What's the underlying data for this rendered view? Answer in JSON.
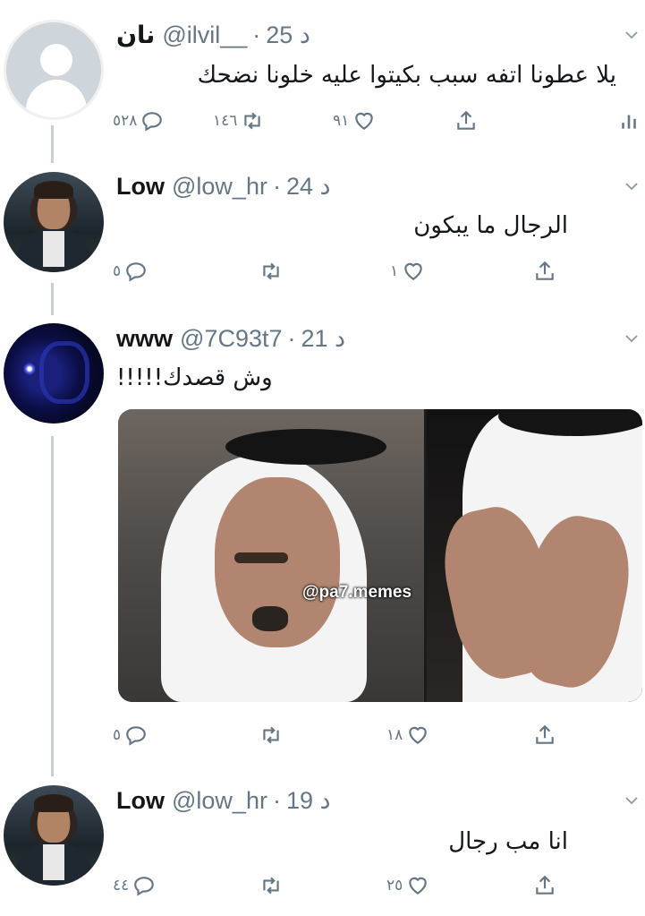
{
  "thread": [
    {
      "name": "نان",
      "handle": "@ilvil__",
      "time": "25 د",
      "separator": "·",
      "text": "يلا عطونا اتفه سبب بكيتوا عليه خلونا نضحك",
      "replies": "٥٢٨",
      "retweets": "١٤٦",
      "likes": "٩١",
      "avatar_icon": "default-avatar-icon"
    },
    {
      "name": "Low",
      "handle": "@low_hr",
      "time": "24 د",
      "separator": "·",
      "text": "الرجال ما يبكون",
      "replies": "٥",
      "retweets": "",
      "likes": "١",
      "avatar_icon": "profile-photo"
    },
    {
      "name": "www",
      "handle": "@7C93t7",
      "time": "21 د",
      "separator": "·",
      "text": "وش قصدك!!!!!",
      "replies": "٥",
      "retweets": "",
      "likes": "١٨",
      "avatar_icon": "profile-photo",
      "media_watermark": "@pa7.memes"
    },
    {
      "name": "Low",
      "handle": "@low_hr",
      "time": "19 د",
      "separator": "·",
      "text": "انا مب رجال",
      "replies": "٤٤",
      "retweets": "",
      "likes": "٢٥",
      "avatar_icon": "profile-photo"
    }
  ],
  "icons": {
    "reply": "reply-icon",
    "retweet": "retweet-icon",
    "like": "heart-icon",
    "share": "share-icon",
    "analytics": "analytics-icon",
    "more": "chevron-down-icon"
  },
  "colors": {
    "text": "#14171a",
    "muted": "#657786",
    "line": "#c4cfd6"
  }
}
